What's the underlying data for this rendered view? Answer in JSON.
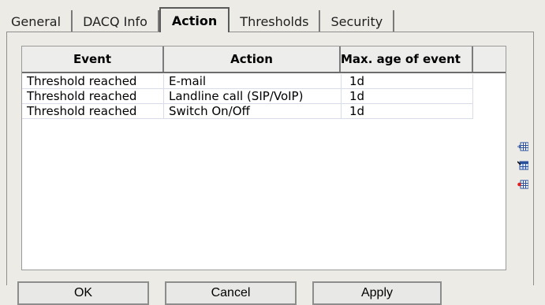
{
  "tabs": [
    {
      "label": "General",
      "active": false
    },
    {
      "label": "DACQ Info",
      "active": false
    },
    {
      "label": "Action",
      "active": true
    },
    {
      "label": "Thresholds",
      "active": false
    },
    {
      "label": "Security",
      "active": false
    }
  ],
  "table": {
    "columns": [
      "Event",
      "Action",
      "Max. age of event"
    ],
    "rows": [
      {
        "event": "Threshold reached",
        "action": "E-mail",
        "max_age": "1d"
      },
      {
        "event": "Threshold reached",
        "action": "Landline call (SIP/VoIP)",
        "max_age": "1d"
      },
      {
        "event": "Threshold reached",
        "action": "Switch On/Off",
        "max_age": "1d"
      }
    ]
  },
  "side_icons": [
    "add-row-icon",
    "edit-row-icon",
    "delete-row-icon"
  ],
  "buttons": {
    "ok_label": "OK",
    "cancel_label": "Cancel",
    "apply_label": "Apply"
  }
}
